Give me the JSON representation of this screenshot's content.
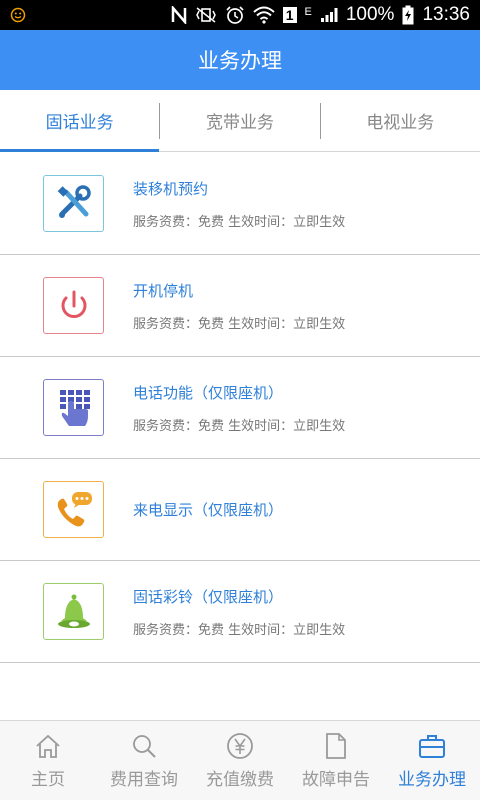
{
  "status_bar": {
    "left_icon": "face-icon",
    "icons": [
      "nfc-n-icon",
      "vibrate-icon",
      "alarm-icon",
      "wifi-icon",
      "sim-1-icon",
      "edge-e-icon",
      "signal-icon"
    ],
    "sim_label": "1",
    "network_label": "E",
    "battery": "100%",
    "time": "13:36"
  },
  "header": {
    "title": "业务办理"
  },
  "tabs": [
    {
      "label": "固话业务",
      "active": true
    },
    {
      "label": "宽带业务",
      "active": false
    },
    {
      "label": "电视业务",
      "active": false
    }
  ],
  "services": [
    {
      "icon": "tools-icon",
      "title": "装移机预约",
      "desc": "服务资费：免费 生效时间：立即生效",
      "border": "#7cc6dc"
    },
    {
      "icon": "power-icon",
      "title": "开机停机",
      "desc": "服务资费：免费 生效时间：立即生效",
      "border": "#e8838a"
    },
    {
      "icon": "keypad-icon",
      "title": "电话功能（仅限座机）",
      "desc": "服务资费：免费 生效时间：立即生效",
      "border": "#7c7fc8"
    },
    {
      "icon": "caller-id-icon",
      "title": "来电显示（仅限座机）",
      "desc": "",
      "border": "#f0b04a"
    },
    {
      "icon": "bell-icon",
      "title": "固话彩铃（仅限座机）",
      "desc": "服务资费：免费 生效时间：立即生效",
      "border": "#9ccd6a"
    }
  ],
  "bottom_nav": [
    {
      "label": "主页",
      "icon": "home-icon",
      "active": false
    },
    {
      "label": "费用查询",
      "icon": "search-icon",
      "active": false
    },
    {
      "label": "充值缴费",
      "icon": "yen-icon",
      "active": false
    },
    {
      "label": "故障申告",
      "icon": "document-icon",
      "active": false
    },
    {
      "label": "业务办理",
      "icon": "briefcase-icon",
      "active": true
    }
  ],
  "colors": {
    "accent": "#3d8ff3",
    "link": "#2f80d8"
  }
}
